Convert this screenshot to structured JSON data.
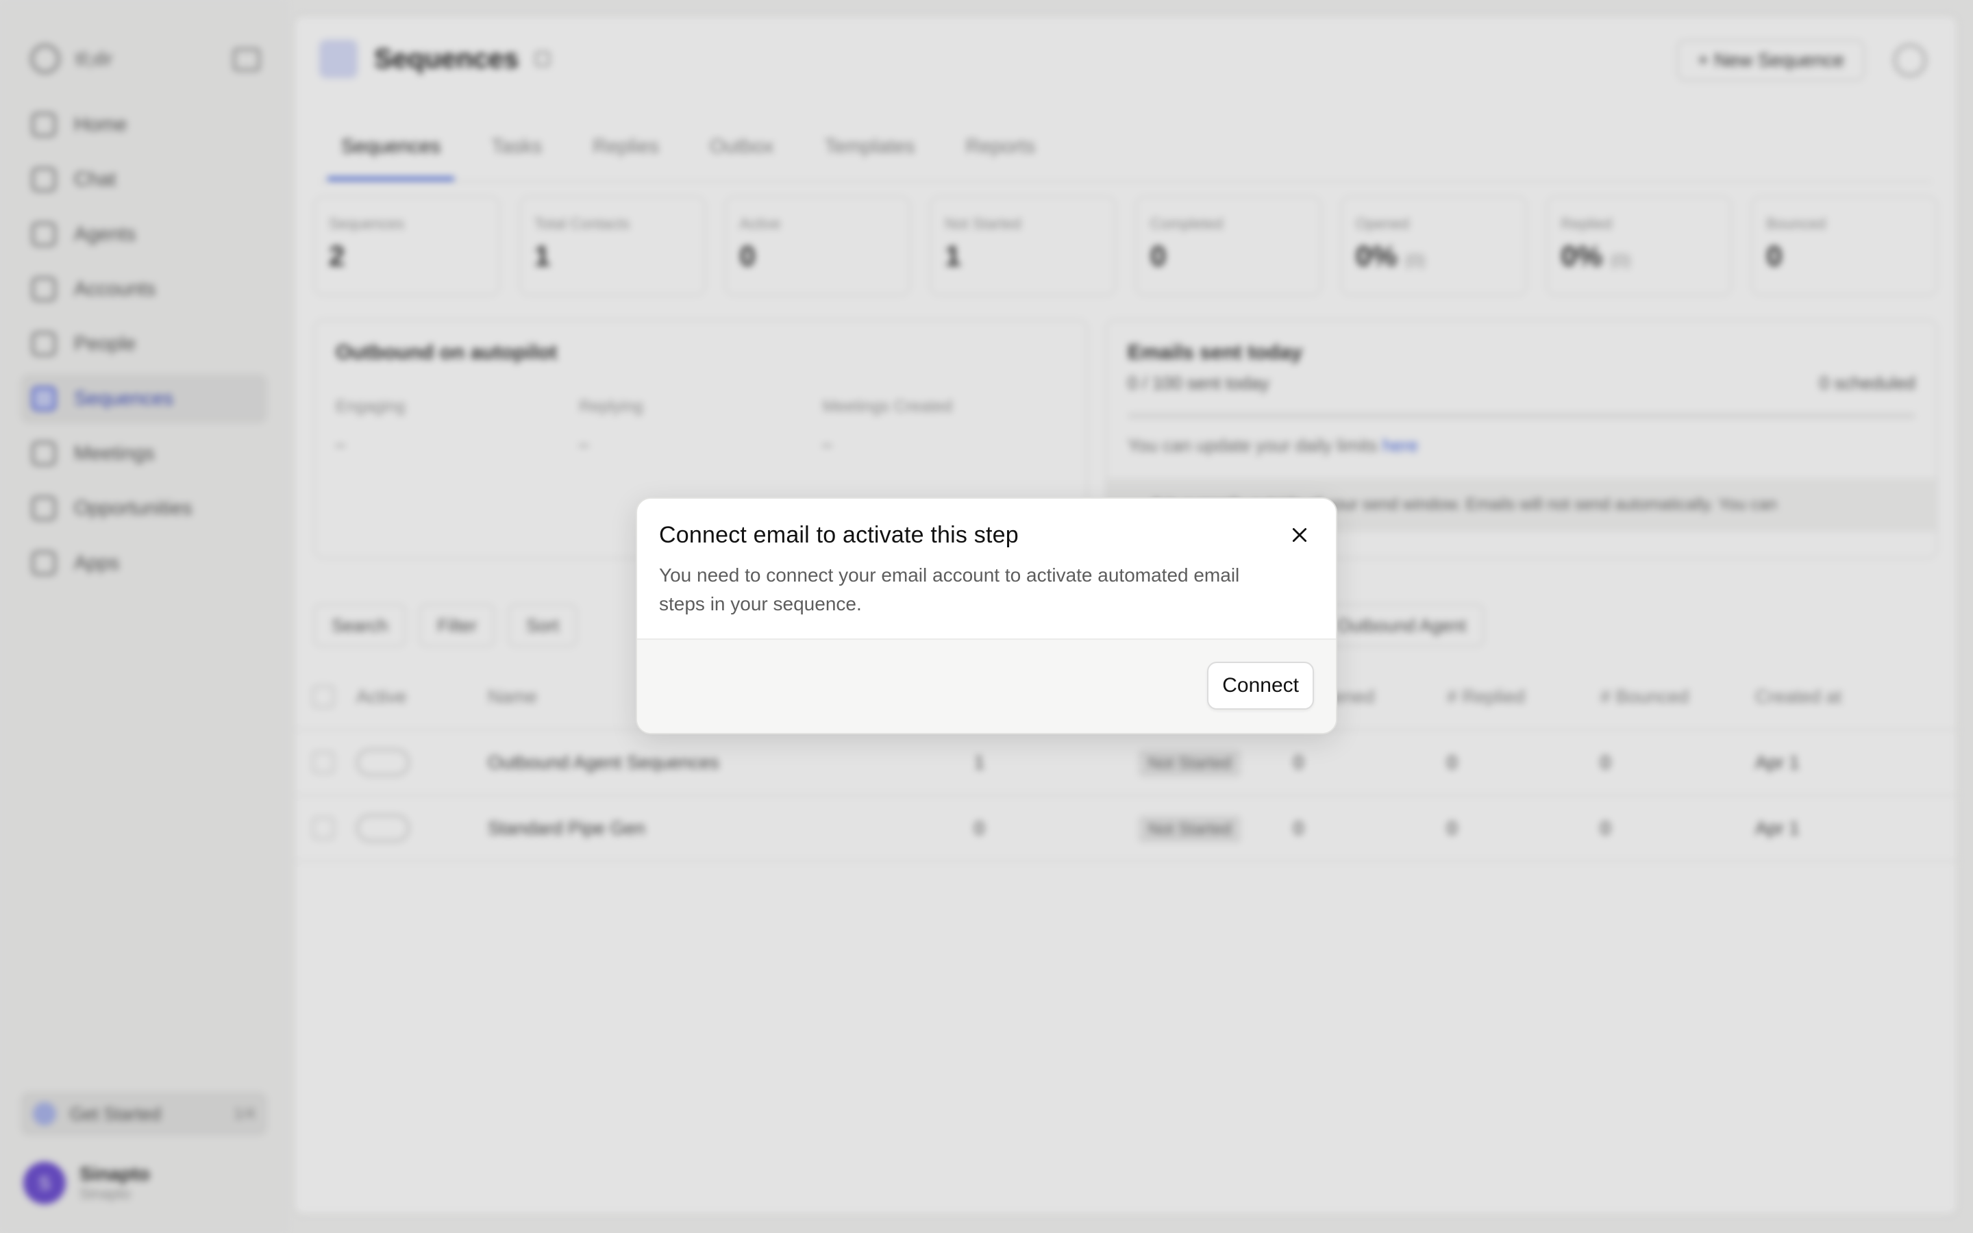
{
  "sidebar": {
    "brand": "tl;dr",
    "items": [
      {
        "label": "Home",
        "icon": "home-icon"
      },
      {
        "label": "Chat",
        "icon": "chat-icon"
      },
      {
        "label": "Agents",
        "icon": "agents-icon"
      },
      {
        "label": "Accounts",
        "icon": "accounts-icon"
      },
      {
        "label": "People",
        "icon": "people-icon"
      },
      {
        "label": "Sequences",
        "icon": "sequences-icon",
        "active": true
      },
      {
        "label": "Meetings",
        "icon": "meetings-icon"
      },
      {
        "label": "Opportunities",
        "icon": "opportunities-icon"
      },
      {
        "label": "Apps",
        "icon": "apps-icon"
      }
    ],
    "getting_started": {
      "label": "Get Started",
      "progress": "1/4"
    },
    "user": {
      "initial": "S",
      "name": "Sinapto",
      "sub": "Sinapto"
    }
  },
  "header": {
    "title": "Sequences",
    "new_button": "+ New Sequence"
  },
  "tabs": [
    "Sequences",
    "Tasks",
    "Replies",
    "Outbox",
    "Templates",
    "Reports"
  ],
  "stats": [
    {
      "label": "Sequences",
      "value": "2",
      "sub": ""
    },
    {
      "label": "Total Contacts",
      "value": "1",
      "sub": ""
    },
    {
      "label": "Active",
      "value": "0",
      "sub": ""
    },
    {
      "label": "Not Started",
      "value": "1",
      "sub": ""
    },
    {
      "label": "Completed",
      "value": "0",
      "sub": ""
    },
    {
      "label": "Opened",
      "value": "0%",
      "sub": "(0)"
    },
    {
      "label": "Replied",
      "value": "0%",
      "sub": "(0)"
    },
    {
      "label": "Bounced",
      "value": "0",
      "sub": ""
    }
  ],
  "autopilot": {
    "title": "Outbound on autopilot",
    "cols": [
      {
        "label": "Engaging",
        "value": "–"
      },
      {
        "label": "Replying",
        "value": "–"
      },
      {
        "label": "Meetings Created",
        "value": "–"
      }
    ]
  },
  "emails": {
    "title": "Emails sent today",
    "sent": "0 / 100 sent today",
    "scheduled": "0 scheduled",
    "note": "You can update your daily limits ",
    "note_link": "here",
    "warning": "It is currently outside of your send window. Emails will not send automatically. You can"
  },
  "toolbar": {
    "search": "Search",
    "filter": "Filter",
    "sort": "Sort",
    "agent": "Outbound Agent"
  },
  "table": {
    "headers": [
      "Active",
      "Name",
      "",
      "",
      "# Opened",
      "# Replied",
      "# Bounced",
      "Created at"
    ],
    "rows": [
      {
        "name": "Outbound Agent Sequences",
        "contacts": "1",
        "status": "Not Started",
        "opened": "0",
        "replied": "0",
        "bounced": "0",
        "created": "Apr 1"
      },
      {
        "name": "Standard Pipe Gen",
        "contacts": "0",
        "status": "Not Started",
        "opened": "0",
        "replied": "0",
        "bounced": "0",
        "created": "Apr 1"
      }
    ]
  },
  "dialog": {
    "title": "Connect email to activate this step",
    "text": "You need to connect your email account to activate automated email steps in your sequence.",
    "connect_label": "Connect",
    "close_icon": "close-icon"
  }
}
